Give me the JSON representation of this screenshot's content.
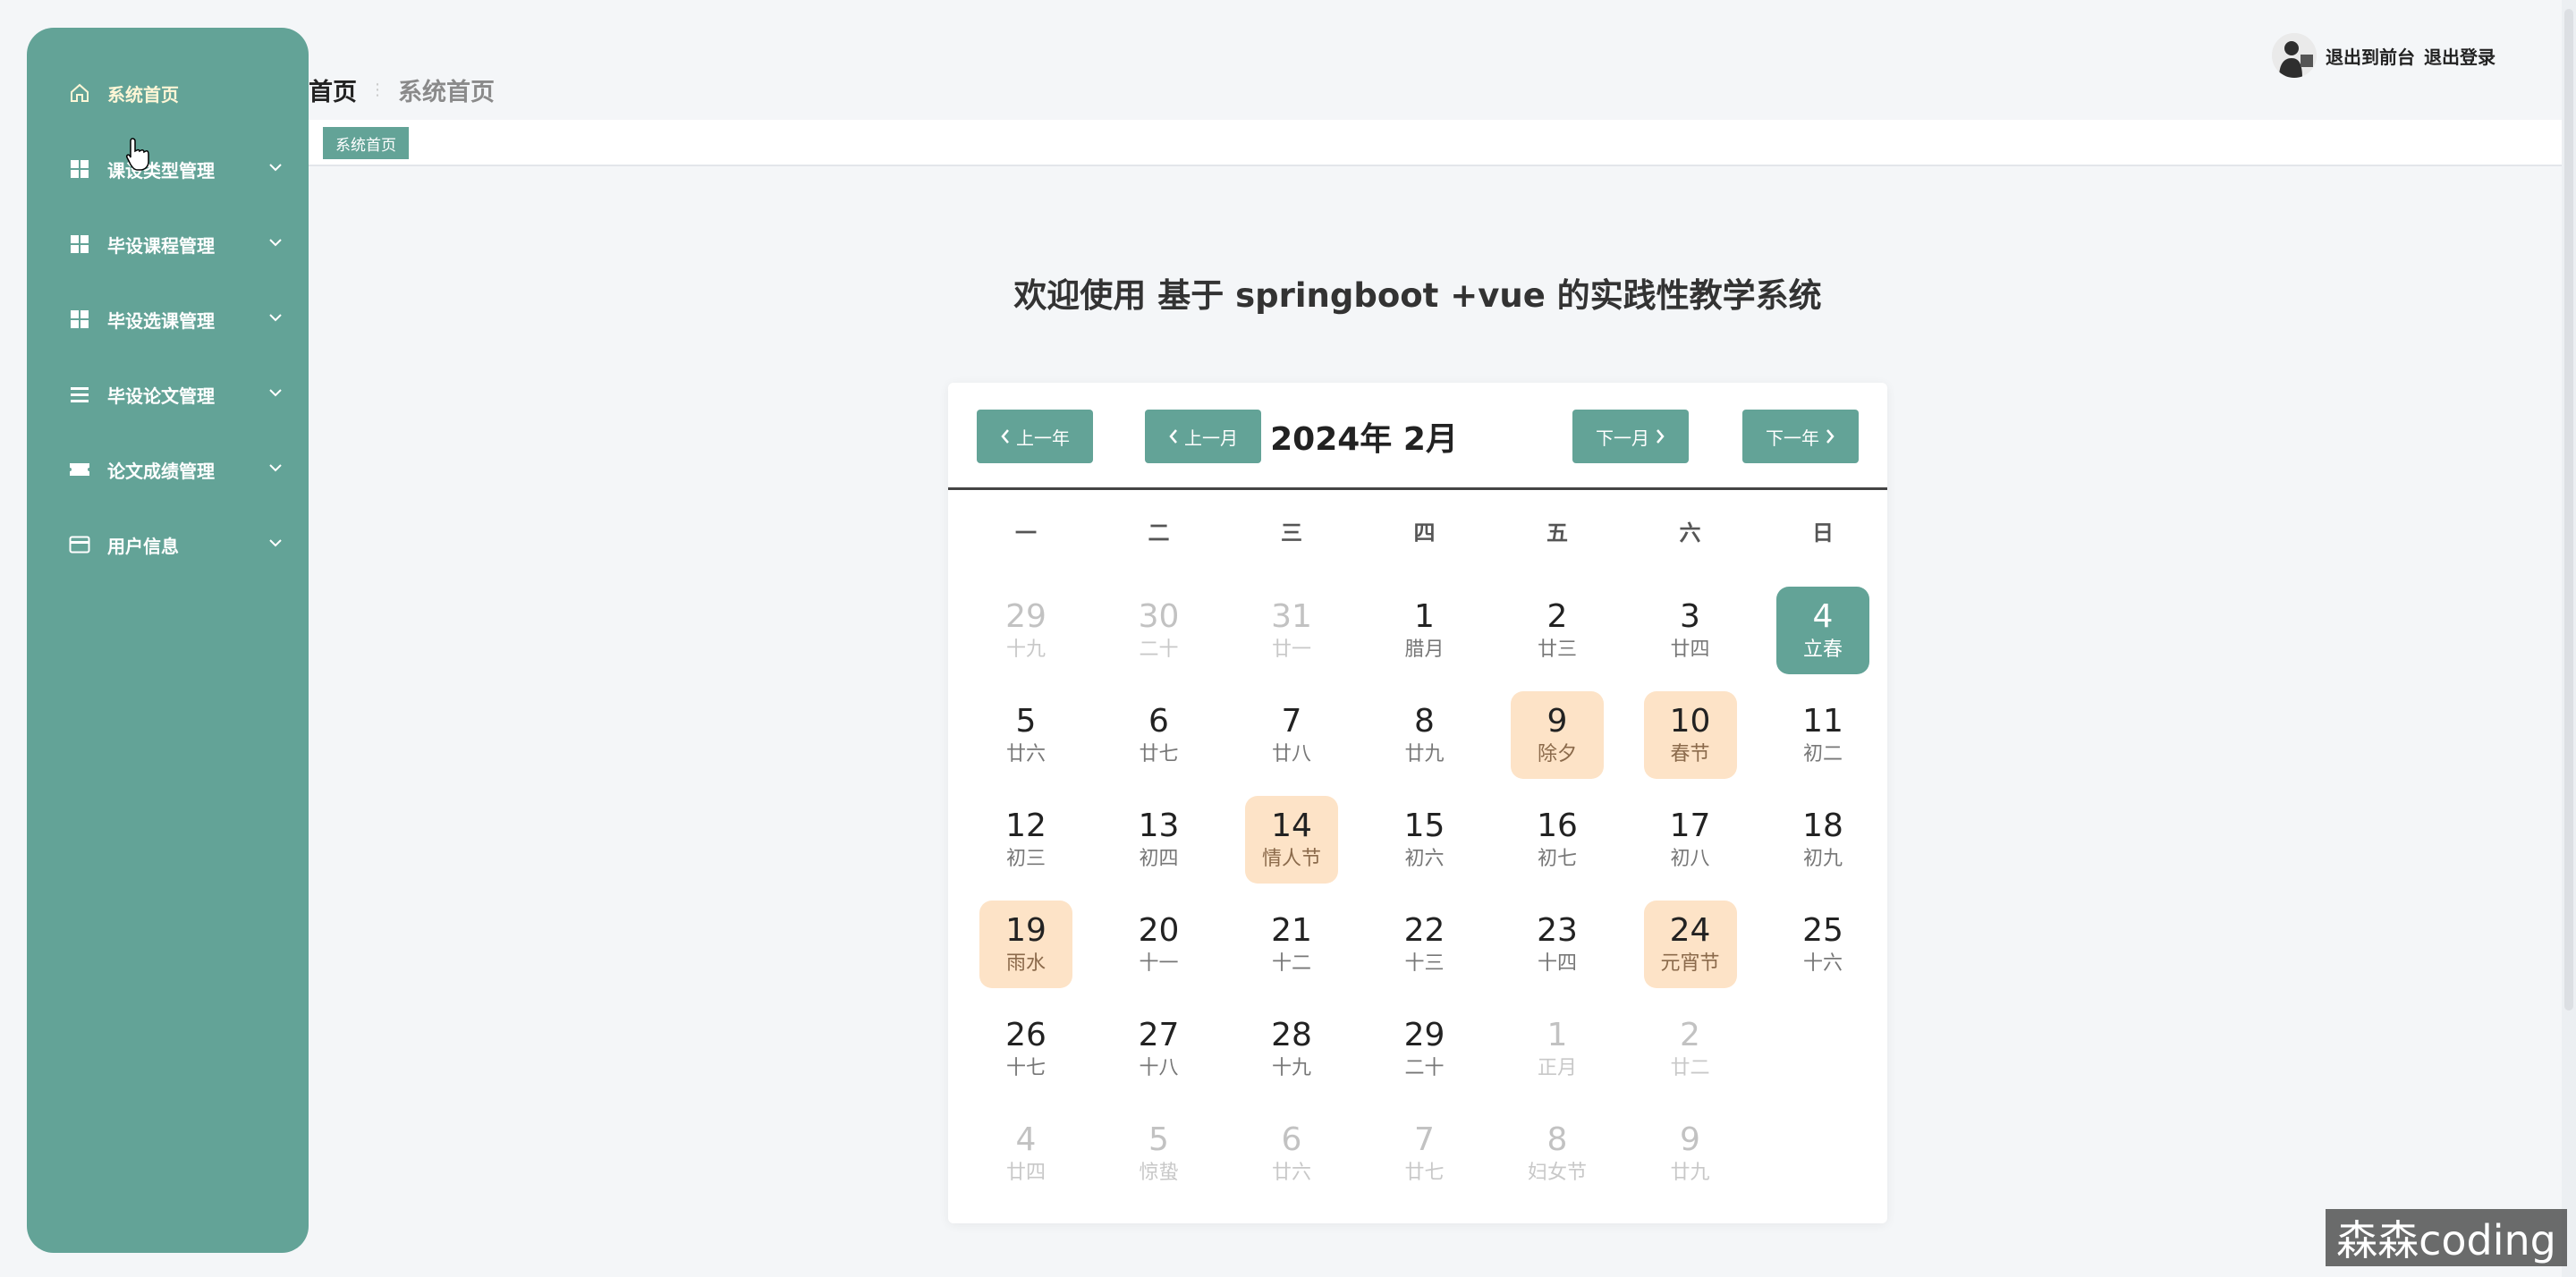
{
  "sidebar": {
    "items": [
      {
        "label": "系统首页",
        "icon": "home-icon"
      },
      {
        "label": "课设类型管理",
        "icon": "grid-icon"
      },
      {
        "label": "毕设课程管理",
        "icon": "grid-icon"
      },
      {
        "label": "毕设选课管理",
        "icon": "grid-icon"
      },
      {
        "label": "毕设论文管理",
        "icon": "list-icon"
      },
      {
        "label": "论文成绩管理",
        "icon": "ticket-icon"
      },
      {
        "label": "用户信息",
        "icon": "card-icon"
      }
    ]
  },
  "header": {
    "breadcrumb_home": "首页",
    "breadcrumb_current": "系统首页",
    "links": [
      "退出到前台",
      "退出登录"
    ],
    "tag": "系统首页"
  },
  "welcome": "欢迎使用 基于 springboot +vue 的实践性教学系统",
  "calendar": {
    "title": "2024年 2月",
    "buttons": {
      "prev_year": "上一年",
      "prev_month": "上一月",
      "next_month": "下一月",
      "next_year": "下一年"
    },
    "weekdays": [
      "一",
      "二",
      "三",
      "四",
      "五",
      "六",
      "日"
    ],
    "weeks": [
      [
        {
          "d": "29",
          "s": "十九",
          "o": 1
        },
        {
          "d": "30",
          "s": "二十",
          "o": 1
        },
        {
          "d": "31",
          "s": "廿一",
          "o": 1
        },
        {
          "d": "1",
          "s": "腊月"
        },
        {
          "d": "2",
          "s": "廿三"
        },
        {
          "d": "3",
          "s": "廿四"
        },
        {
          "d": "4",
          "s": "立春",
          "t": 1
        }
      ],
      [
        {
          "d": "5",
          "s": "廿六"
        },
        {
          "d": "6",
          "s": "廿七"
        },
        {
          "d": "7",
          "s": "廿八"
        },
        {
          "d": "8",
          "s": "廿九"
        },
        {
          "d": "9",
          "s": "除夕",
          "h": 1
        },
        {
          "d": "10",
          "s": "春节",
          "h": 1
        },
        {
          "d": "11",
          "s": "初二"
        }
      ],
      [
        {
          "d": "12",
          "s": "初三"
        },
        {
          "d": "13",
          "s": "初四"
        },
        {
          "d": "14",
          "s": "情人节",
          "h": 1
        },
        {
          "d": "15",
          "s": "初六"
        },
        {
          "d": "16",
          "s": "初七"
        },
        {
          "d": "17",
          "s": "初八"
        },
        {
          "d": "18",
          "s": "初九"
        }
      ],
      [
        {
          "d": "19",
          "s": "雨水",
          "h": 1
        },
        {
          "d": "20",
          "s": "十一"
        },
        {
          "d": "21",
          "s": "十二"
        },
        {
          "d": "22",
          "s": "十三"
        },
        {
          "d": "23",
          "s": "十四"
        },
        {
          "d": "24",
          "s": "元宵节",
          "h": 1
        },
        {
          "d": "25",
          "s": "十六"
        }
      ],
      [
        {
          "d": "26",
          "s": "十七"
        },
        {
          "d": "27",
          "s": "十八"
        },
        {
          "d": "28",
          "s": "十九"
        },
        {
          "d": "29",
          "s": "二十"
        },
        {
          "d": "1",
          "s": "正月",
          "o": 1
        },
        {
          "d": "2",
          "s": "廿二",
          "o": 1
        },
        {
          "d": "",
          "s": "",
          "o": 1
        }
      ],
      [
        {
          "d": "4",
          "s": "廿四",
          "o": 1
        },
        {
          "d": "5",
          "s": "惊蛰",
          "o": 1
        },
        {
          "d": "6",
          "s": "廿六",
          "o": 1
        },
        {
          "d": "7",
          "s": "廿七",
          "o": 1
        },
        {
          "d": "8",
          "s": "妇女节",
          "o": 1
        },
        {
          "d": "9",
          "s": "廿九",
          "o": 1
        },
        {
          "d": "",
          "s": "",
          "o": 1
        }
      ]
    ]
  },
  "watermark": "森森coding",
  "colors": {
    "primary": "#63a397",
    "holiday": "#fde3c7",
    "background": "#f4f6f8"
  }
}
